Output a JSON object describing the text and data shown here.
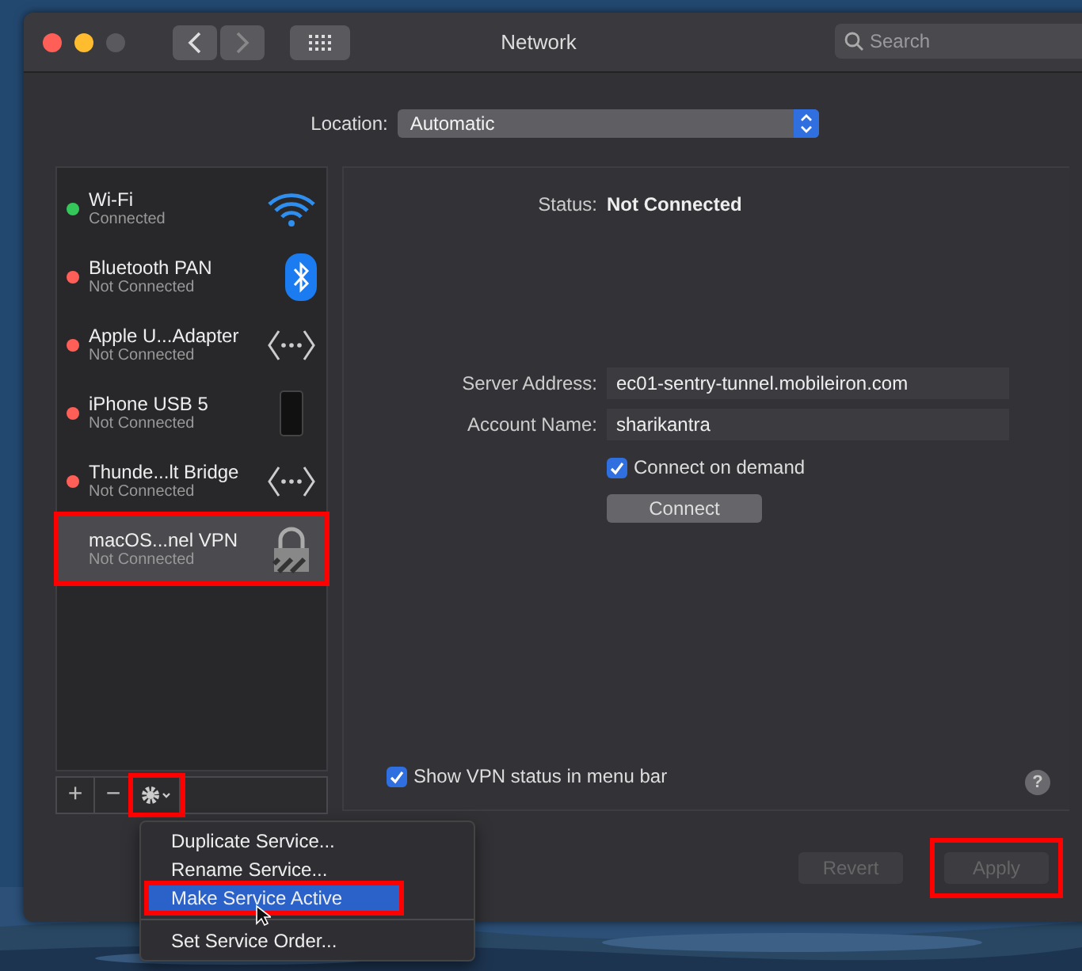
{
  "window": {
    "title": "Network",
    "search": {
      "placeholder": "Search"
    }
  },
  "location": {
    "label": "Location:",
    "value": "Automatic"
  },
  "services": [
    {
      "name": "Wi-Fi",
      "status": "Connected",
      "color": "#34c759",
      "kind": "wifi",
      "selected": false,
      "highlighted": false
    },
    {
      "name": "Bluetooth PAN",
      "status": "Not Connected",
      "color": "#ff5f57",
      "kind": "bluetooth",
      "selected": false,
      "highlighted": false
    },
    {
      "name": "Apple U...Adapter",
      "status": "Not Connected",
      "color": "#ff5f57",
      "kind": "ethernet",
      "selected": false,
      "highlighted": false
    },
    {
      "name": "iPhone USB 5",
      "status": "Not Connected",
      "color": "#ff5f57",
      "kind": "phone",
      "selected": false,
      "highlighted": false
    },
    {
      "name": "Thunde...lt Bridge",
      "status": "Not Connected",
      "color": "#ff5f57",
      "kind": "ethernet",
      "selected": false,
      "highlighted": false
    },
    {
      "name": "macOS...nel VPN",
      "status": "Not Connected",
      "kind": "vpn",
      "selected": true,
      "highlighted": true
    }
  ],
  "toolbar": {
    "add": "+",
    "remove": "−",
    "gear_highlighted": true
  },
  "detail": {
    "status_label": "Status:",
    "status_value": "Not Connected",
    "fields": [
      {
        "label": "Server Address:",
        "value": "ec01-sentry-tunnel.mobileiron.com"
      },
      {
        "label": "Account Name:",
        "value": "sharikantra"
      }
    ],
    "connect_on_demand": {
      "label": "Connect on demand",
      "checked": true
    },
    "connect_button": "Connect",
    "show_status": {
      "label": "Show VPN status in menu bar",
      "checked": true
    },
    "help": "?"
  },
  "buttons": [
    {
      "label": "Revert",
      "disabled": true,
      "highlighted": false
    },
    {
      "label": "Apply",
      "disabled": true,
      "highlighted": true
    }
  ],
  "menu": [
    {
      "kind": "item",
      "label": "Duplicate Service...",
      "selected": false,
      "highlighted": false
    },
    {
      "kind": "item",
      "label": "Rename Service...",
      "selected": false,
      "highlighted": false
    },
    {
      "kind": "item",
      "label": "Make Service Active",
      "selected": true,
      "highlighted": true
    },
    {
      "kind": "separator"
    },
    {
      "kind": "item",
      "label": "Set Service Order...",
      "selected": false,
      "highlighted": false
    }
  ]
}
